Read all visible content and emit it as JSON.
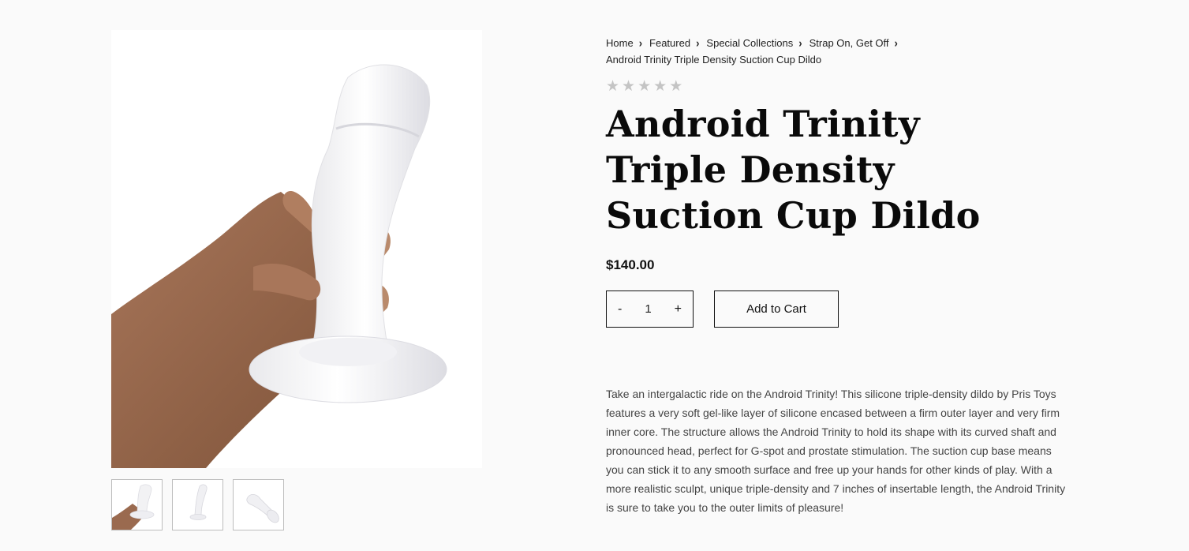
{
  "breadcrumb": {
    "items": [
      {
        "label": "Home"
      },
      {
        "label": "Featured"
      },
      {
        "label": "Special Collections"
      },
      {
        "label": "Strap On, Get Off"
      }
    ],
    "current": "Android Trinity Triple Density Suction Cup Dildo",
    "separator": "›"
  },
  "rating": {
    "stars": 0,
    "max": 5,
    "star_glyph": "★",
    "empty_color": "#c4c4c4"
  },
  "product": {
    "title": "Android Trinity Triple Density Suction Cup Dildo",
    "price": "$140.00",
    "quantity": "1",
    "decrement_label": "-",
    "increment_label": "+",
    "add_to_cart_label": "Add to Cart",
    "description": "Take an intergalactic ride on the Android Trinity! This silicone triple-density dildo by Pris Toys features a very soft gel-like layer of silicone encased between a firm outer layer and very firm inner core. The structure allows the Android Trinity to hold its shape with its curved shaft and pronounced head, perfect for G-spot and prostate stimulation. The suction cup base means you can stick it to any smooth surface and free up your hands for other kinds of play. With a more realistic sculpt, unique triple-density and 7 inches of insertable length, the Android Trinity is sure to take you to the outer limits of pleasure!"
  },
  "gallery": {
    "thumbnail_count": 3,
    "selected_index": 0
  },
  "colors": {
    "background": "#fafafa",
    "text": "#111111",
    "muted_text": "#444444",
    "border": "#111111"
  }
}
